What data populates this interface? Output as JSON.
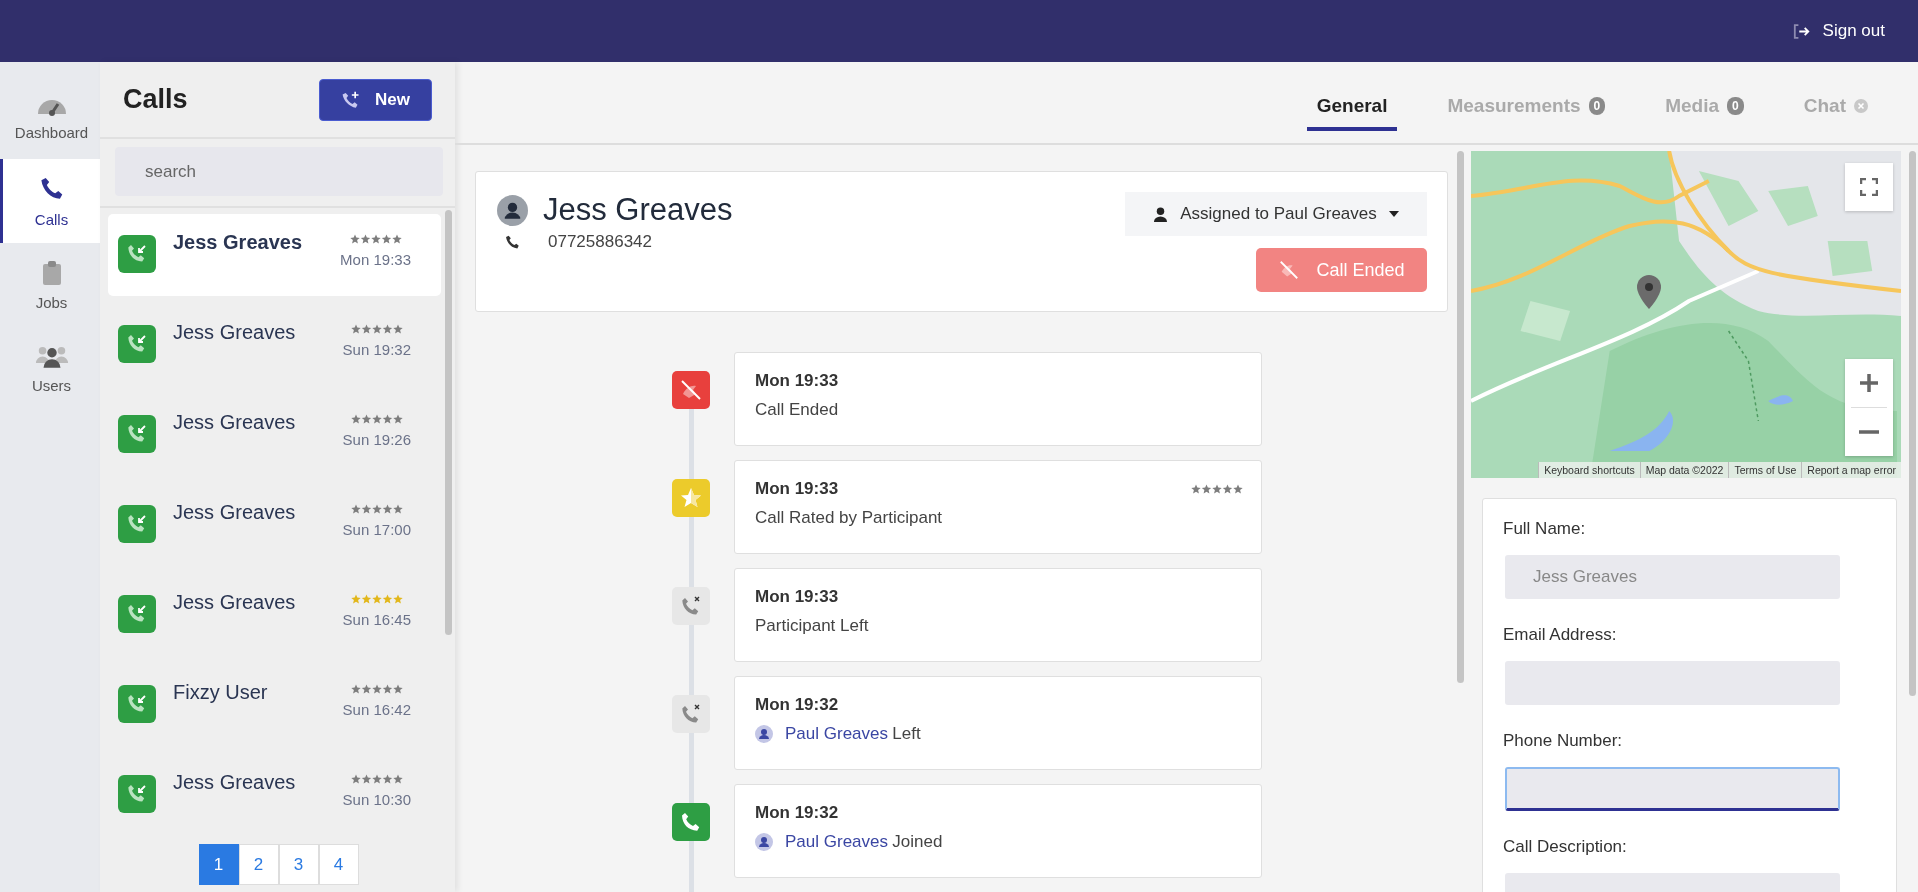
{
  "top_bar": {
    "sign_out": "Sign out"
  },
  "nav": [
    {
      "kind": "dashboard",
      "label": "Dashboard",
      "selected": false
    },
    {
      "kind": "calls",
      "label": "Calls",
      "selected": true
    },
    {
      "kind": "jobs",
      "label": "Jobs",
      "selected": false
    },
    {
      "kind": "users",
      "label": "Users",
      "selected": false
    }
  ],
  "calls_panel": {
    "title": "Calls",
    "new_button": "New",
    "search": {
      "placeholder": "search"
    },
    "calls": [
      {
        "name": "Jess Greaves",
        "time": "Mon 19:33",
        "stars": 5,
        "highlighted": false,
        "selected": true
      },
      {
        "name": "Jess Greaves",
        "time": "Sun 19:32",
        "stars": 5,
        "highlighted": false,
        "selected": false
      },
      {
        "name": "Jess Greaves",
        "time": "Sun 19:26",
        "stars": 5,
        "highlighted": false,
        "selected": false
      },
      {
        "name": "Jess Greaves",
        "time": "Sun 17:00",
        "stars": 5,
        "highlighted": false,
        "selected": false
      },
      {
        "name": "Jess Greaves",
        "time": "Sun 16:45",
        "stars": 5,
        "highlighted": true,
        "selected": false
      },
      {
        "name": "Fixzy User",
        "time": "Sun 16:42",
        "stars": 5,
        "highlighted": false,
        "selected": false
      },
      {
        "name": "Jess Greaves",
        "time": "Sun 10:30",
        "stars": 5,
        "highlighted": false,
        "selected": false
      }
    ],
    "pages": [
      {
        "label": "1",
        "selected": true
      },
      {
        "label": "2",
        "selected": false
      },
      {
        "label": "3",
        "selected": false
      },
      {
        "label": "4",
        "selected": false
      }
    ]
  },
  "tabs": [
    {
      "label": "General",
      "kind": "plain",
      "selected": true
    },
    {
      "label": "Measurements",
      "kind": "count",
      "badge": "0",
      "selected": false
    },
    {
      "label": "Media",
      "kind": "count",
      "badge": "0",
      "selected": false
    },
    {
      "label": "Chat",
      "kind": "closable",
      "selected": false
    }
  ],
  "caller": {
    "name": "Jess Greaves",
    "phone": "07725886342",
    "assigned": "Assigned to Paul Greaves",
    "status_button": "Call Ended"
  },
  "timeline": [
    {
      "kind": "ended",
      "time": "Mon 19:33",
      "text": "Call Ended"
    },
    {
      "kind": "rated",
      "time": "Mon 19:33",
      "text": "Call Rated by Participant",
      "stars": 5
    },
    {
      "kind": "left",
      "time": "Mon 19:33",
      "text": "Participant Left"
    },
    {
      "kind": "left",
      "time": "Mon 19:32",
      "person": "Paul Greaves",
      "text": "Left"
    },
    {
      "kind": "joined",
      "time": "Mon 19:32",
      "person": "Paul Greaves",
      "text": "Joined"
    }
  ],
  "map": {
    "attribution": [
      "Keyboard shortcuts",
      "Map data ©2022",
      "Terms of Use",
      "Report a map error"
    ]
  },
  "form": [
    {
      "label": "Full Name:",
      "placeholder": "Jess Greaves",
      "focused": false
    },
    {
      "label": "Email Address:",
      "focused": false
    },
    {
      "label": "Phone Number:",
      "focused": true
    },
    {
      "label": "Call Description:",
      "focused": false
    }
  ]
}
